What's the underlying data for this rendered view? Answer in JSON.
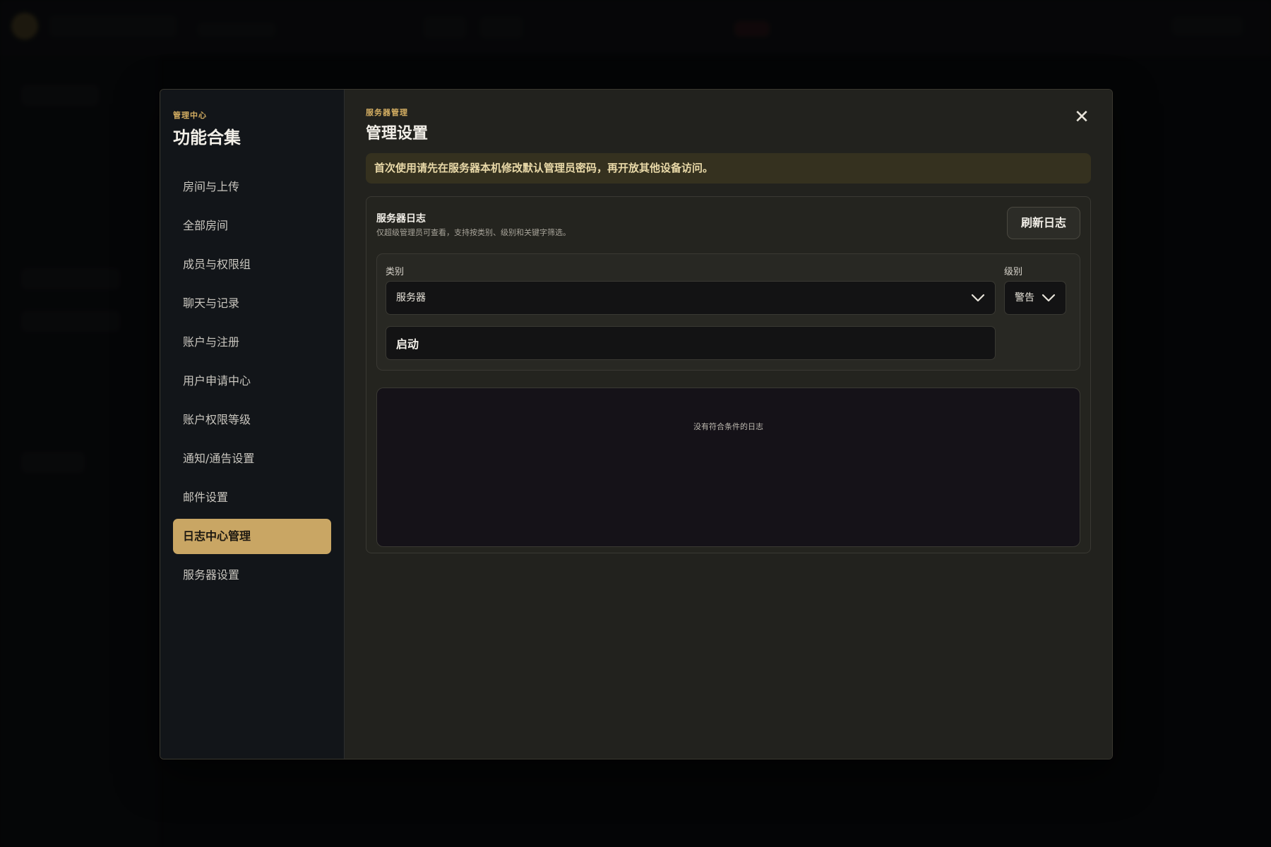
{
  "sidebar": {
    "kicker": "管理中心",
    "title": "功能合集",
    "items": [
      {
        "label": "房间与上传",
        "active": false
      },
      {
        "label": "全部房间",
        "active": false
      },
      {
        "label": "成员与权限组",
        "active": false
      },
      {
        "label": "聊天与记录",
        "active": false
      },
      {
        "label": "账户与注册",
        "active": false
      },
      {
        "label": "用户申请中心",
        "active": false
      },
      {
        "label": "账户权限等级",
        "active": false
      },
      {
        "label": "通知/通告设置",
        "active": false
      },
      {
        "label": "邮件设置",
        "active": false
      },
      {
        "label": "日志中心管理",
        "active": true
      },
      {
        "label": "服务器设置",
        "active": false
      }
    ]
  },
  "header": {
    "kicker": "服务器管理",
    "title": "管理设置",
    "close_symbol": "✕"
  },
  "notice": "首次使用请先在服务器本机修改默认管理员密码，再开放其他设备访问。",
  "log_panel": {
    "title": "服务器日志",
    "subtitle": "仅超级管理员可查看，支持按类别、级别和关键字筛选。",
    "refresh_label": "刷新日志",
    "filters": {
      "category_label": "类别",
      "category_value": "服务器",
      "level_label": "级别",
      "level_value": "警告",
      "keyword_value": "启动"
    },
    "empty_text": "没有符合条件的日志"
  },
  "colors": {
    "accent": "#c9a664",
    "kicker": "#d4ae62",
    "notice_bg": "#35311f",
    "sidebar_bg": "#121519",
    "main_bg": "#22221e"
  }
}
